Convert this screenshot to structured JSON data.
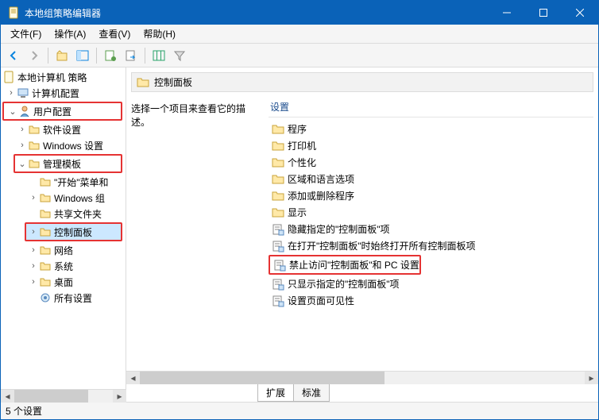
{
  "titlebar": {
    "title": "本地组策略编辑器"
  },
  "menu": [
    "文件(F)",
    "操作(A)",
    "查看(V)",
    "帮助(H)"
  ],
  "tree": {
    "root": "本地计算机 策略",
    "computer_config": "计算机配置",
    "user_config": "用户配置",
    "software": "软件设置",
    "windows_settings": "Windows 设置",
    "admin_templates": "管理模板",
    "start_menu": "\"开始\"菜单和",
    "windows_components": "Windows 组",
    "shared_folders": "共享文件夹",
    "control_panel": "控制面板",
    "network": "网络",
    "system": "系统",
    "desktop": "桌面",
    "all_settings": "所有设置"
  },
  "content": {
    "header": "控制面板",
    "desc": "选择一个项目来查看它的描述。",
    "col_setting": "设置",
    "items": [
      {
        "type": "folder",
        "label": "程序"
      },
      {
        "type": "folder",
        "label": "打印机"
      },
      {
        "type": "folder",
        "label": "个性化"
      },
      {
        "type": "folder",
        "label": "区域和语言选项"
      },
      {
        "type": "folder",
        "label": "添加或删除程序"
      },
      {
        "type": "folder",
        "label": "显示"
      },
      {
        "type": "setting",
        "label": "隐藏指定的\"控制面板\"项"
      },
      {
        "type": "setting",
        "label": "在打开\"控制面板\"时始终打开所有控制面板项"
      },
      {
        "type": "setting",
        "label": "禁止访问\"控制面板\"和 PC 设置",
        "highlight": true
      },
      {
        "type": "setting",
        "label": "只显示指定的\"控制面板\"项"
      },
      {
        "type": "setting",
        "label": "设置页面可见性"
      }
    ]
  },
  "tabs": [
    "扩展",
    "标准"
  ],
  "status": "5 个设置"
}
